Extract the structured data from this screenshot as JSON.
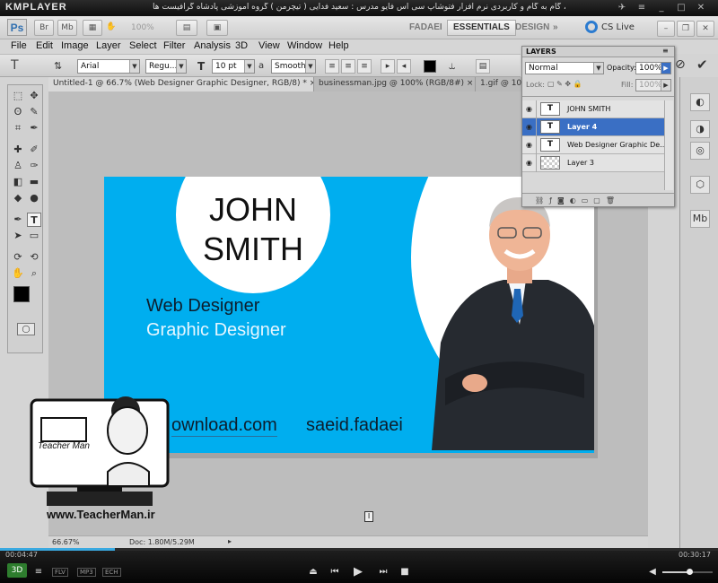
{
  "player": {
    "logo": "KMPLAYER",
    "title": "مجموعه آموزشی جامع ، گام به گام و کاربردی نرم افزار فتوشاپ سی اس فایو  مدرس : سعید فدایی ( تیچرمن ) گروه آموزشی پادشاه گرافیست ها",
    "time_elapsed": "00:04:47",
    "time_total": "00:30:17",
    "badges": [
      "FLV",
      "MP3",
      "ECH"
    ],
    "watermark_url": "www.TeacherMan.ir",
    "watermark_brand": "Teacher Man"
  },
  "appbar": {
    "logo": "Ps",
    "zoom": "100%",
    "workspaces": [
      "FADAEI",
      "ESSENTIALS",
      "DESIGN"
    ],
    "more": "»",
    "cs_live": "CS Live"
  },
  "menu": [
    "File",
    "Edit",
    "Image",
    "Layer",
    "Select",
    "Filter",
    "Analysis",
    "3D",
    "View",
    "Window",
    "Help"
  ],
  "options": {
    "font_family": "Arial",
    "font_style": "Regu...",
    "font_size": "10 pt",
    "aa_label": "a",
    "antialias": "Smooth"
  },
  "tabs": [
    {
      "label": "Untitled-1 @ 66.7% (Web Designer Graphic Designer, RGB/8) *",
      "close": "×"
    },
    {
      "label": "businessman.jpg @ 100% (RGB/8#)",
      "close": "×"
    },
    {
      "label": "1.gif @ 10",
      "close": ""
    }
  ],
  "card": {
    "first_name": "JOHN",
    "last_name": "SMITH",
    "role1": "Web Designer",
    "role2": "Graphic Designer",
    "website": "ownload.com",
    "handle": "saeid.fadaei"
  },
  "status": {
    "zoom": "66.67%",
    "doc": "Doc: 1.80M/5.29M"
  },
  "layers_panel": {
    "title": "LAYERS",
    "blend_mode": "Normal",
    "opacity_label": "Opacity:",
    "opacity": "100%",
    "lock_label": "Lock:",
    "fill_label": "Fill:",
    "fill": "100%",
    "layers": [
      {
        "name": "JOHN SMITH",
        "thumb": "T",
        "selected": false
      },
      {
        "name": "Layer 4",
        "thumb": "T",
        "selected": true
      },
      {
        "name": "Web Designer Graphic De...",
        "thumb": "T",
        "selected": false
      },
      {
        "name": "Layer 3",
        "thumb": "",
        "selected": false
      }
    ]
  },
  "colors": {
    "card_blue": "#00aeef",
    "layer_selected": "#3a6fc4"
  }
}
